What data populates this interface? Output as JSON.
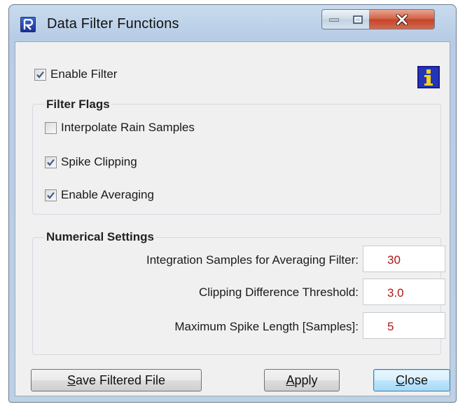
{
  "window": {
    "title": "Data Filter Functions"
  },
  "enable_filter": {
    "label": "Enable Filter",
    "checked": true
  },
  "filter_flags": {
    "title": "Filter Flags",
    "items": [
      {
        "label": "Interpolate Rain Samples",
        "checked": false
      },
      {
        "label": "Spike Clipping",
        "checked": true
      },
      {
        "label": "Enable Averaging",
        "checked": true
      }
    ]
  },
  "numerical_settings": {
    "title": "Numerical Settings",
    "fields": [
      {
        "label": "Integration Samples for Averaging Filter:",
        "value": "30"
      },
      {
        "label": "Clipping Difference Threshold:",
        "value": "3.0"
      },
      {
        "label": "Maximum Spike Length [Samples]:",
        "value": "5"
      }
    ]
  },
  "buttons": {
    "save": {
      "mnemonic": "S",
      "rest": "ave Filtered File"
    },
    "apply": {
      "mnemonic": "A",
      "rest": "pply"
    },
    "close": {
      "mnemonic": "C",
      "rest": "lose"
    }
  },
  "colors": {
    "value_text": "#b01818",
    "info_icon": "#2436b8"
  },
  "icons": {
    "app": "app-logo-icon",
    "info": "info-icon"
  }
}
